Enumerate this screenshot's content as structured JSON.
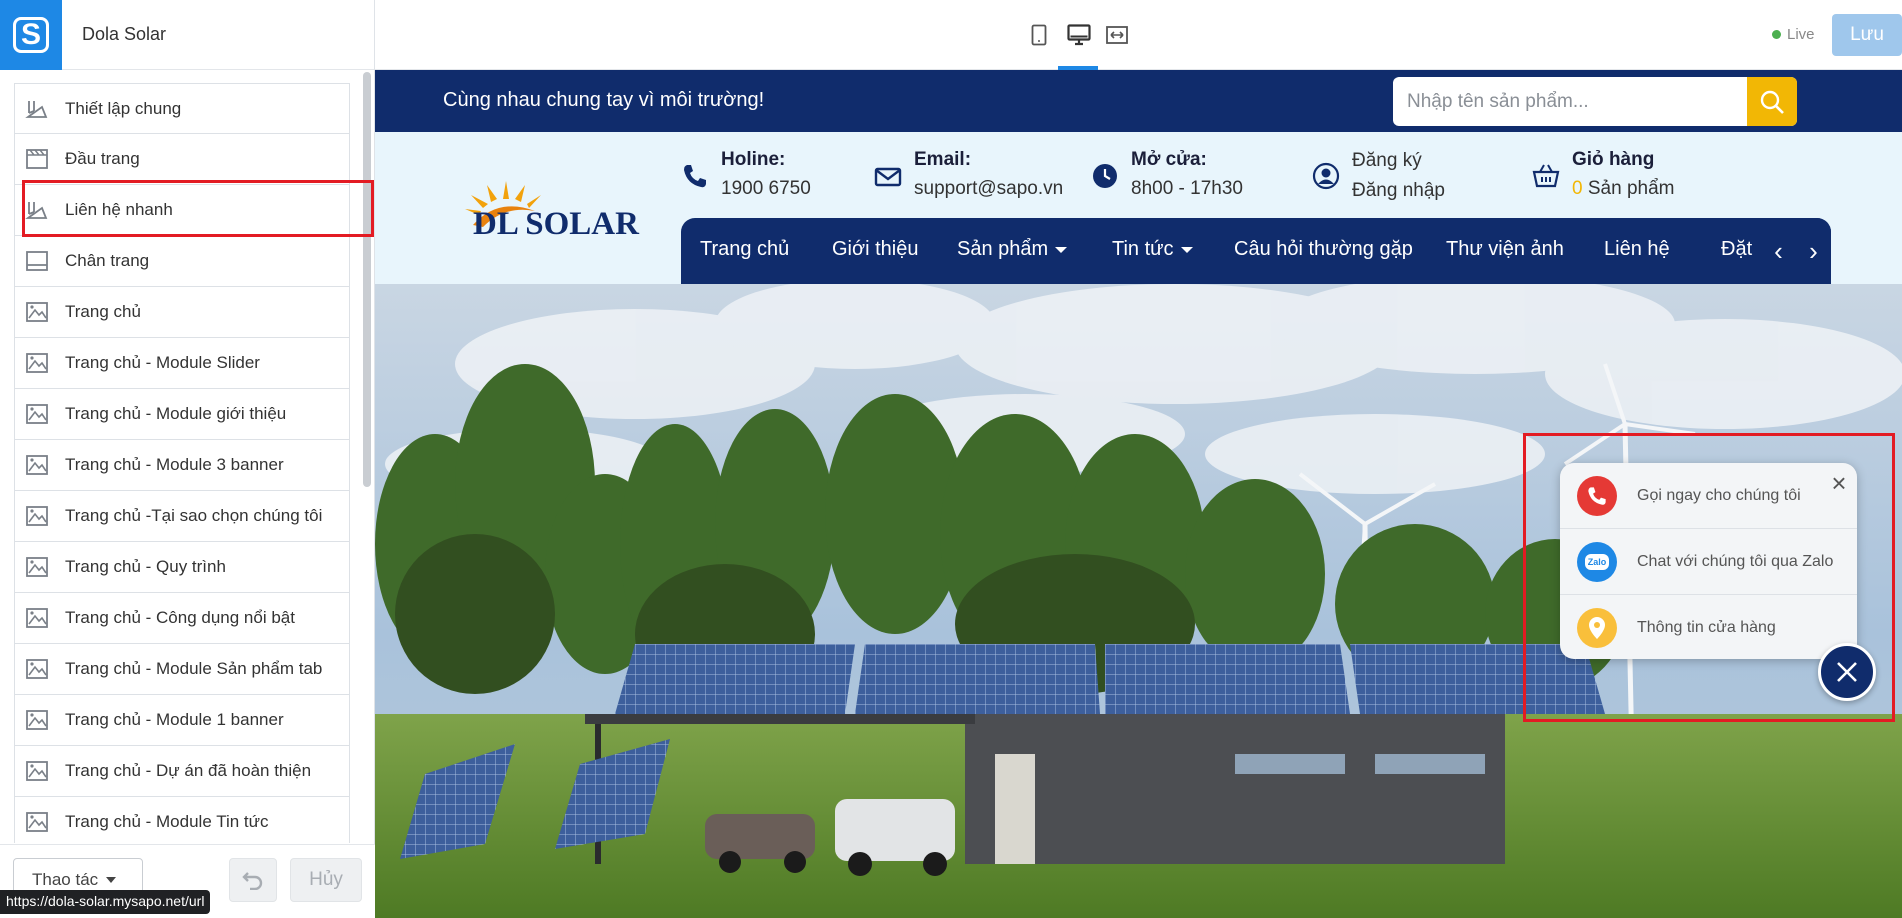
{
  "app": {
    "store_name": "Dola Solar",
    "live_label": "Live",
    "save_label": "Lưu"
  },
  "devices": [
    "mobile-icon",
    "desktop-icon",
    "fullwidth-icon"
  ],
  "sidebar": {
    "items": [
      {
        "label": "Thiết lập chung",
        "icon": "settings-brush-icon"
      },
      {
        "label": "Đầu trang",
        "icon": "header-icon"
      },
      {
        "label": "Liên hệ nhanh",
        "icon": "settings-brush-icon"
      },
      {
        "label": "Chân trang",
        "icon": "footer-icon"
      },
      {
        "label": "Trang chủ",
        "icon": "page-icon"
      },
      {
        "label": "Trang chủ - Module Slider",
        "icon": "page-icon"
      },
      {
        "label": "Trang chủ - Module giới thiệu",
        "icon": "page-icon"
      },
      {
        "label": "Trang chủ - Module 3 banner",
        "icon": "page-icon"
      },
      {
        "label": "Trang chủ -Tại sao chọn chúng tôi",
        "icon": "page-icon"
      },
      {
        "label": "Trang chủ - Quy trình",
        "icon": "page-icon"
      },
      {
        "label": "Trang chủ - Công dụng nổi bật",
        "icon": "page-icon"
      },
      {
        "label": "Trang chủ - Module Sản phẩm tab",
        "icon": "page-icon"
      },
      {
        "label": "Trang chủ - Module 1 banner",
        "icon": "page-icon"
      },
      {
        "label": "Trang chủ - Dự án đã hoàn thiện",
        "icon": "page-icon"
      },
      {
        "label": "Trang chủ - Module Tin tức",
        "icon": "page-icon"
      }
    ],
    "actions_label": "Thao tác",
    "cancel_label": "Hủy",
    "status_url": "https://dola-solar.mysapo.net/url"
  },
  "site": {
    "slogan": "Cùng nhau chung tay vì môi trường!",
    "search_placeholder": "Nhập tên sản phẩm...",
    "brand": "DL SOLAR",
    "hotline_title": "Holine:",
    "hotline_value": "1900 6750",
    "email_title": "Email:",
    "email_value": "support@sapo.vn",
    "hours_title": "Mở cửa:",
    "hours_value": "8h00 - 17h30",
    "register": "Đăng ký",
    "login": "Đăng nhập",
    "cart_title": "Giỏ hàng",
    "cart_count": "0",
    "cart_unit": "Sản phẩm",
    "nav": [
      "Trang chủ",
      "Giới thiệu",
      "Sản phẩm",
      "Tin tức",
      "Câu hỏi thường gặp",
      "Thư viện ảnh",
      "Liên hệ",
      "Đặt"
    ]
  },
  "contact_widget": {
    "call": "Gọi ngay cho chúng tôi",
    "zalo": "Chat với chúng tôi qua Zalo",
    "zalo_badge": "Zalo",
    "store": "Thông tin cửa hàng"
  },
  "colors": {
    "primary": "#102c6c",
    "accent": "#f2b705",
    "brand_blue": "#1e88e5",
    "highlight": "#e31b23"
  }
}
